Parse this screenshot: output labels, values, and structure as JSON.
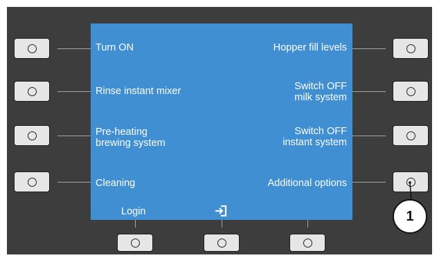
{
  "left_menu": [
    {
      "label": "Turn ON"
    },
    {
      "label": "Rinse instant mixer"
    },
    {
      "label_line1": "Pre-heating",
      "label_line2": "brewing system"
    },
    {
      "label": "Cleaning"
    }
  ],
  "right_menu": [
    {
      "label": "Hopper fill levels"
    },
    {
      "label_line1": "Switch OFF",
      "label_line2": "milk system"
    },
    {
      "label_line1": "Switch OFF",
      "label_line2": "instant system"
    },
    {
      "label": "Additional options"
    }
  ],
  "bottom_bar": {
    "login_label": "Login",
    "center_icon": "enter-icon"
  },
  "callout": {
    "number": "1"
  },
  "colors": {
    "panel": "#3d3d3d",
    "screen": "#3f8fd2",
    "button": "#e6e6e6",
    "text": "#ffffff"
  }
}
